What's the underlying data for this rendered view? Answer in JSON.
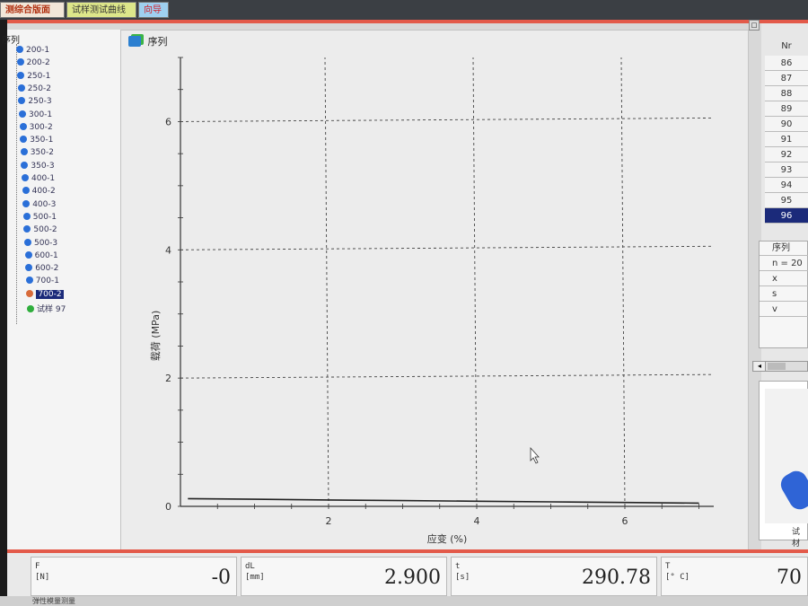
{
  "tabs": [
    {
      "label": "测综合版面"
    },
    {
      "label": "试样测试曲线"
    },
    {
      "label": "向导"
    }
  ],
  "tree": {
    "root": "序列",
    "items": [
      "200-1",
      "200-2",
      "250-1",
      "250-2",
      "250-3",
      "300-1",
      "300-2",
      "350-1",
      "350-2",
      "350-3",
      "400-1",
      "400-2",
      "400-3",
      "500-1",
      "500-2",
      "500-3",
      "600-1",
      "600-2",
      "700-1",
      "700-2",
      "试样 97"
    ],
    "selected_index": 19
  },
  "chart_panel": {
    "title": "序列"
  },
  "chart_data": {
    "type": "line",
    "xlabel": "应变 (%)",
    "ylabel": "载荷 (MPa)",
    "xlim": [
      0,
      7.2
    ],
    "ylim": [
      0,
      7
    ],
    "x_ticks": [
      "2",
      "4",
      "6"
    ],
    "y_ticks": [
      "0",
      "2",
      "4",
      "6"
    ],
    "grid": true,
    "series": [
      {
        "x": [
          0.1,
          1,
          2,
          3,
          4,
          5,
          6,
          7
        ],
        "values": [
          0.12,
          0.11,
          0.1,
          0.09,
          0.08,
          0.07,
          0.06,
          0.05
        ]
      }
    ]
  },
  "right_table": {
    "header": "Nr",
    "rows": [
      "86",
      "87",
      "88",
      "89",
      "90",
      "91",
      "92",
      "93",
      "94",
      "95",
      "96"
    ],
    "selected": "96"
  },
  "stats": {
    "title": "序列",
    "n": "n = 20",
    "x": "x",
    "s": "s",
    "v": "v"
  },
  "preview": {
    "label": "试材"
  },
  "status": {
    "f_label": "F\n[N]",
    "f_value": "-0",
    "dl_label": "dL\n[mm]",
    "dl_value": "2.900",
    "t_label": "t\n[s]",
    "t_value": "290.78",
    "temp_label": "T\n[° C]",
    "temp_value": "70"
  },
  "footer": {
    "text": "弹性模量测量"
  }
}
